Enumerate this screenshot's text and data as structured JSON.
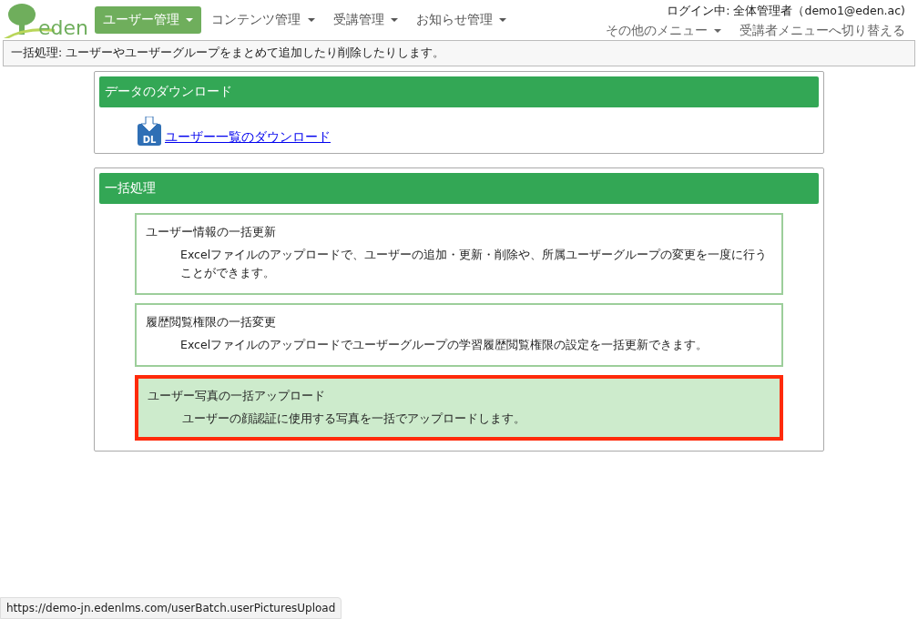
{
  "logo": {
    "text": "eden"
  },
  "nav": [
    {
      "label": "ユーザー管理",
      "selected": true
    },
    {
      "label": "コンテンツ管理",
      "selected": false
    },
    {
      "label": "受講管理",
      "selected": false
    },
    {
      "label": "お知らせ管理",
      "selected": false
    }
  ],
  "user": {
    "login": "ログイン中: 全体管理者（demo1@eden.ac)",
    "other_menu": "その他のメニュー",
    "switch_link": "受講者メニューへ切り替える"
  },
  "info_bar": "一括処理: ユーザーやユーザーグループをまとめて追加したり削除したりします。",
  "download_panel": {
    "title": "データのダウンロード",
    "link": "ユーザー一覧のダウンロード",
    "icon_text": "DL"
  },
  "batch_panel": {
    "title": "一括処理",
    "items": [
      {
        "title": "ユーザー情報の一括更新",
        "description": "Excelファイルのアップロードで、ユーザーの追加・更新・削除や、所属ユーザーグループの変更を一度に行うことができます。",
        "selected": false
      },
      {
        "title": "履歴閲覧権限の一括変更",
        "description": "Excelファイルのアップロードでユーザーグループの学習履歴閲覧権限の設定を一括更新できます。",
        "selected": false
      },
      {
        "title": "ユーザー写真の一括アップロード",
        "description": "ユーザーの顔認証に使用する写真を一括でアップロードします。",
        "selected": true
      }
    ]
  },
  "status_bar": "https://demo-jn.edenlms.com/userBatch.userPicturesUpload"
}
